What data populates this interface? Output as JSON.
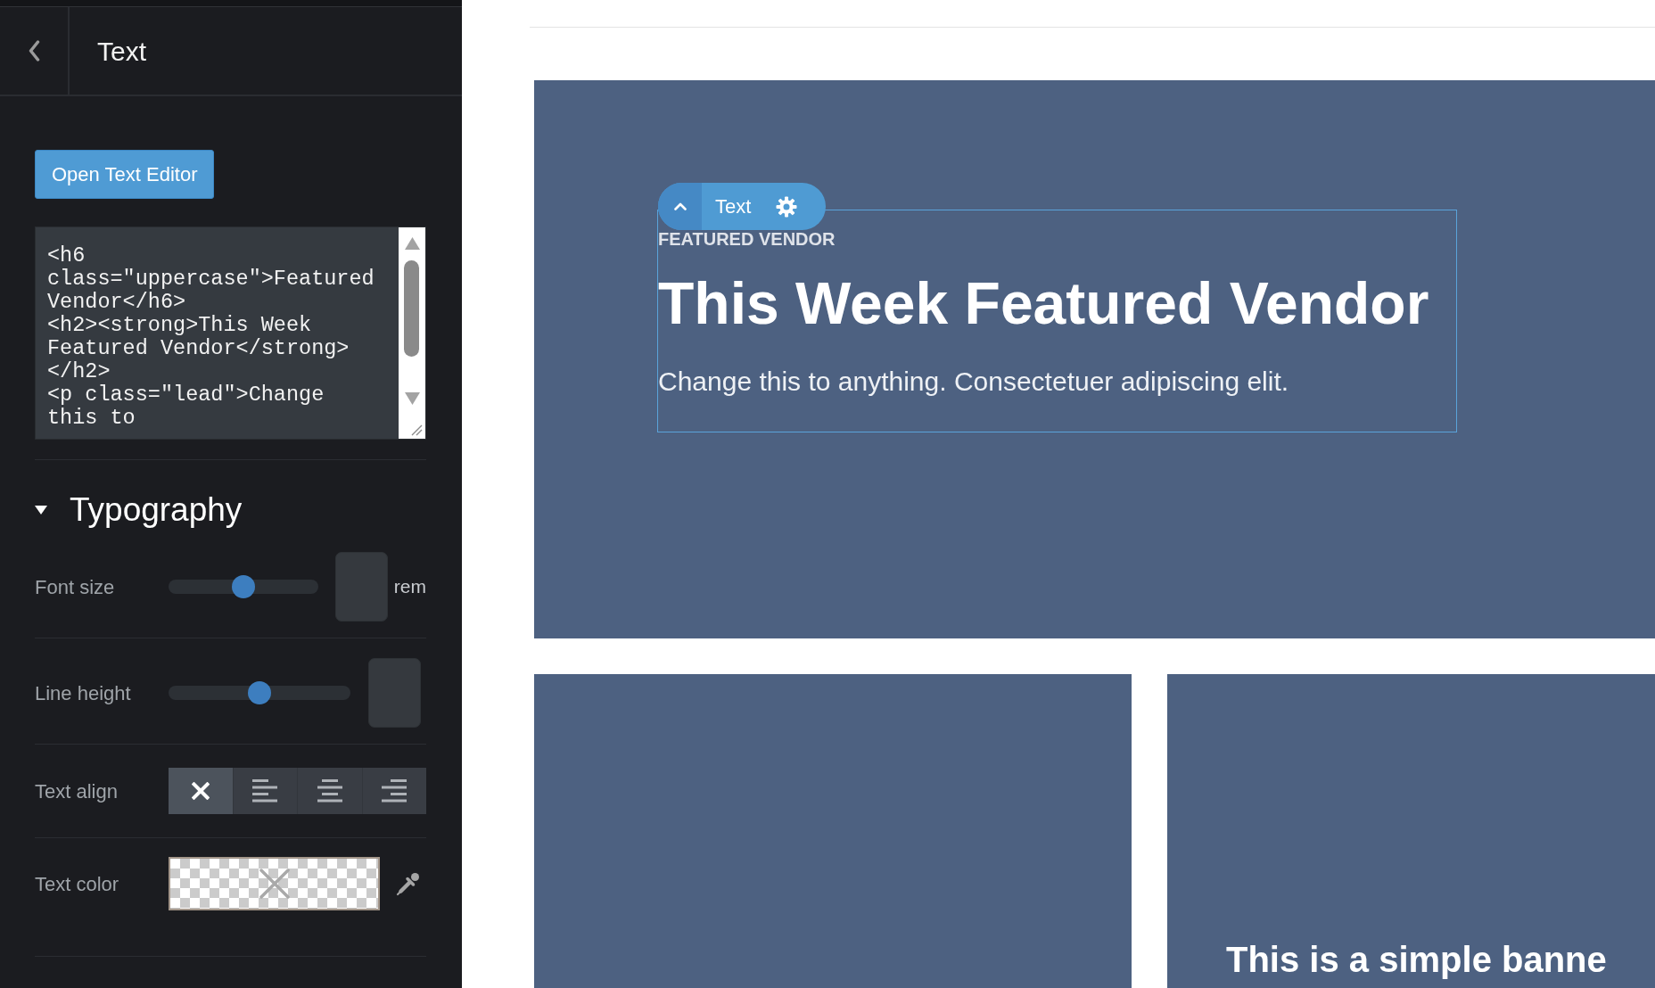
{
  "panel": {
    "title": "Text",
    "open_editor_button": "Open Text Editor",
    "html_source": {
      "lines": [
        "<h6",
        "class=\"uppercase\">Featured",
        "Vendor</h6>",
        "<h2><strong>This Week",
        "Featured Vendor</strong>",
        "</h2>",
        "<p class=\"lead\">Change",
        "this to"
      ]
    },
    "sections": [
      {
        "title": "Typography",
        "expanded": true,
        "controls": [
          {
            "kind": "slider",
            "label": "Font size",
            "level": 0.5,
            "unit": "rem"
          },
          {
            "kind": "slider",
            "label": "Line height",
            "level": 0.5
          },
          {
            "kind": "align",
            "label": "Text align",
            "options": [
              {
                "kind": "none",
                "selected": true
              },
              {
                "kind": "left",
                "selected": false
              },
              {
                "kind": "center",
                "selected": false
              },
              {
                "kind": "right",
                "selected": false
              }
            ]
          },
          {
            "kind": "color",
            "label": "Text color"
          }
        ]
      }
    ]
  },
  "canvas": {
    "hero": {
      "block": {
        "selected": true,
        "toolbar_label": "Text",
        "eyebrow": "FEATURED VENDOR",
        "heading": "This Week Featured Vendor",
        "lead": "Change this to anything. Consectetuer adipiscing elit."
      }
    },
    "cards": [
      {
        "kind": "empty"
      },
      {
        "kind": "banner",
        "heading": "This is a simple banne"
      }
    ]
  }
}
